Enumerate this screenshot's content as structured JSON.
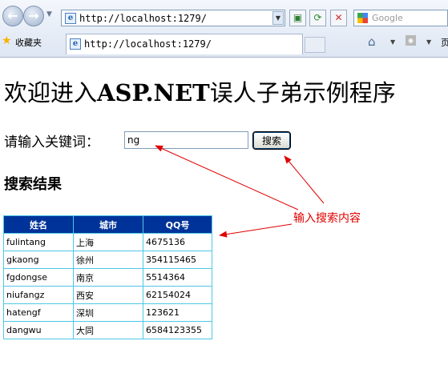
{
  "browser": {
    "url": "http://localhost:1279/",
    "tab_title": "http://localhost:1279/",
    "search_placeholder": "Google",
    "favorites_label": "收藏夹",
    "page_menu_label": "页"
  },
  "page": {
    "title_prefix": "欢迎进入",
    "title_brand": "ASP.NET",
    "title_suffix": "误人子弟示例程序",
    "keyword_label": "请输入关键词：",
    "keyword_value": "ng",
    "search_button_label": "搜索",
    "results_heading": "搜索结果",
    "table": {
      "headers": [
        "姓名",
        "城市",
        "QQ号"
      ],
      "rows": [
        [
          "fulintang",
          "上海",
          "4675136"
        ],
        [
          "gkaong",
          "徐州",
          "354115465"
        ],
        [
          "fgdongse",
          "南京",
          "5514364"
        ],
        [
          "niufangz",
          "西安",
          "62154024"
        ],
        [
          "hatengf",
          "深圳",
          "123621"
        ],
        [
          "dangwu",
          "大同",
          "6584123355"
        ]
      ]
    }
  },
  "annotation": {
    "text": "输入搜索内容",
    "color": "#e00000"
  },
  "icons": [
    "back-arrow-icon",
    "forward-arrow-icon",
    "page-icon",
    "compatibility-icon",
    "refresh-icon",
    "stop-icon",
    "google-icon",
    "favorites-star-icon",
    "home-icon",
    "rss-icon"
  ]
}
